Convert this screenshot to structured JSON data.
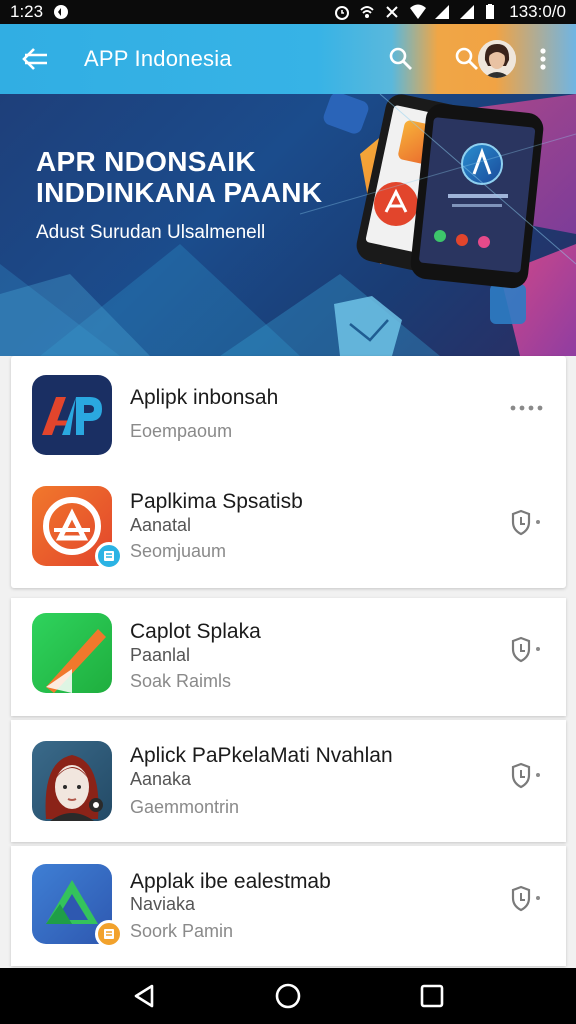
{
  "status_bar": {
    "time": "1:23",
    "clock_right": "133:0/0"
  },
  "app_bar": {
    "title": "APP Indonesia"
  },
  "banner": {
    "headline_line1": "APR NDONSAIK",
    "headline_line2": "INDDINKANA PAANK",
    "subline": "Adust Surudan Ulsalmenell"
  },
  "apps": [
    {
      "name": "Aplipk inbonsah",
      "line2": "Eoempaoum",
      "line3": ""
    },
    {
      "name": "Paplkima Spsatisb",
      "line2": "Aanatal",
      "line3": "Seomjuaum"
    },
    {
      "name": "Caplot Splaka",
      "line2": "Paanlal",
      "line3": "Soak Raimls"
    },
    {
      "name": "Aplick PaPkelaMati Nvahlan",
      "line2": "Aanaka",
      "line3": "Gaemmontrin"
    },
    {
      "name": "Applak ibe ealestmab",
      "line2": "Naviaka",
      "line3": "Soork Pamin"
    }
  ],
  "icons": {
    "back": "back-arrow-icon",
    "search": "search-icon",
    "more": "more-vertical-icon",
    "row_more": "more-horizontal-icon",
    "row_action": "shield-icon"
  },
  "colors": {
    "app_bar": "#37b3e6",
    "banner": "#1b4c8c",
    "accent_orange": "#f1a344"
  }
}
